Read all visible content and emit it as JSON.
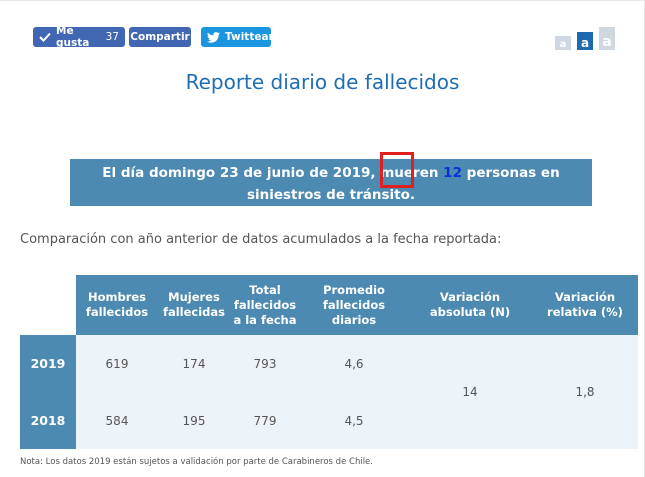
{
  "social": {
    "like_label": "Me gusta",
    "like_count": "37",
    "share_label": "Compartir",
    "tweet_label": "Twittear"
  },
  "font_size_controls": [
    "a",
    "a",
    "a"
  ],
  "page_title": "Reporte diario de fallecidos",
  "banner": {
    "before": "El día domingo 23 de junio de 2019, mueren ",
    "number": "12",
    "after": " personas en siniestros de tránsito."
  },
  "comparison_text": "Comparación con año anterior de datos acumulados a la fecha reportada:",
  "table": {
    "headers": [
      "Hombres fallecidos",
      "Mujeres fallecidas",
      "Total fallecidos a la fecha",
      "Promedio fallecidos diarios",
      "Variación absoluta (N)",
      "Variación relativa (%)"
    ],
    "rows": [
      {
        "year": "2019",
        "hombres": "619",
        "mujeres": "174",
        "total": "793",
        "promedio": "4,6"
      },
      {
        "year": "2018",
        "hombres": "584",
        "mujeres": "195",
        "total": "779",
        "promedio": "4,5"
      }
    ],
    "variacion_absoluta": "14",
    "variacion_relativa": "1,8"
  },
  "note": "Nota: Los datos 2019 están sujetos a validación por parte de Carabineros de Chile.",
  "colors": {
    "accent": "#4d8ab1",
    "title": "#1f6db5",
    "facebook": "#4267b2",
    "twitter": "#1b95e0",
    "highlight_box": "#e02020"
  }
}
